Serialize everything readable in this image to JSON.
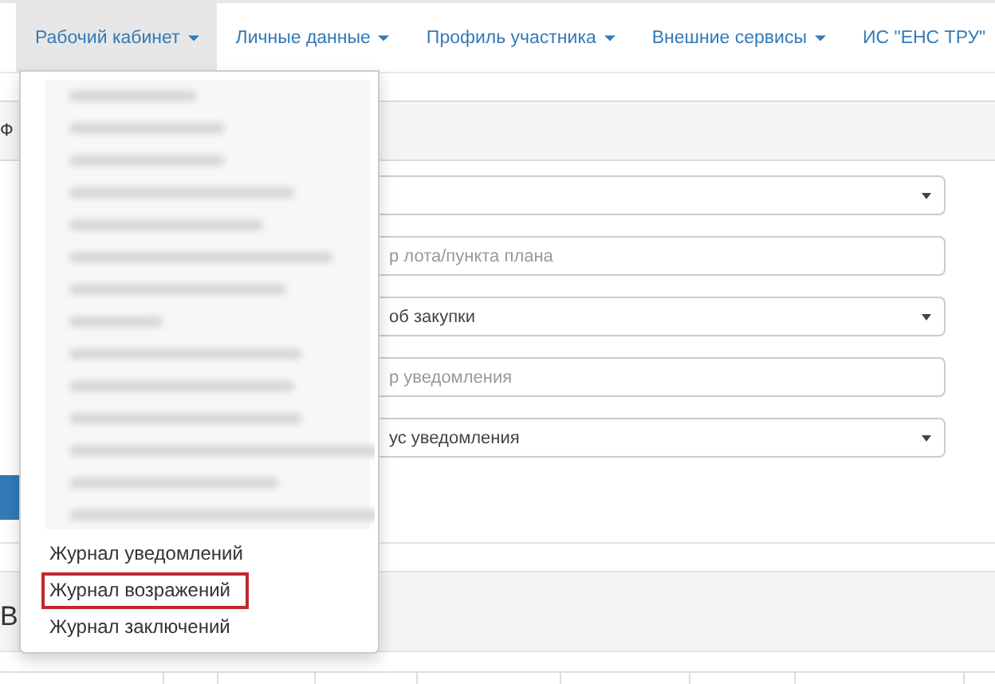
{
  "navbar": {
    "tabs": [
      {
        "label": "Рабочий кабинет",
        "dropdown": true,
        "selected": true
      },
      {
        "label": "Личные данные",
        "dropdown": true,
        "selected": false
      },
      {
        "label": "Профиль участника",
        "dropdown": true,
        "selected": false
      },
      {
        "label": "Внешние сервисы",
        "dropdown": true,
        "selected": false
      },
      {
        "label": "ИС \"ЕНС ТРУ\"",
        "dropdown": false,
        "selected": false
      }
    ]
  },
  "panel": {
    "heading": "Ф",
    "fields": [
      {
        "kind": "select"
      },
      {
        "kind": "input",
        "placeholder": "р лота/пункта плана"
      },
      {
        "kind": "select",
        "value": "об закупки"
      },
      {
        "kind": "input",
        "placeholder": "р уведомления"
      },
      {
        "kind": "select",
        "value": "ус уведомления"
      }
    ]
  },
  "section_title": "В",
  "dropdown_menu": {
    "items": [
      {
        "label": "Журнал уведомлений",
        "highlighted": false
      },
      {
        "label": "Журнал возражений",
        "highlighted": true
      },
      {
        "label": "Журнал заключений",
        "highlighted": false
      }
    ]
  }
}
